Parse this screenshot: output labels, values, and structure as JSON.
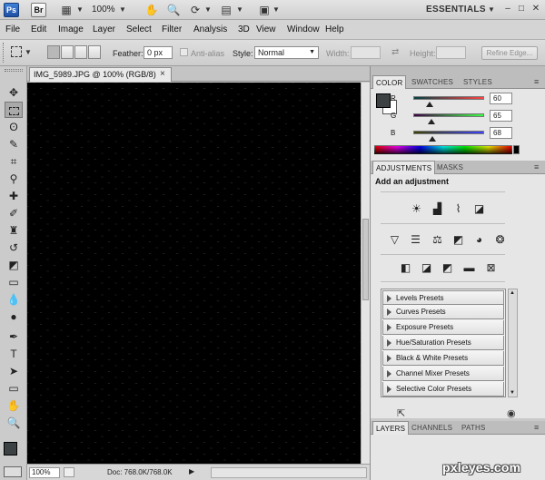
{
  "appbar": {
    "logo": "Ps",
    "bridge": "Br",
    "zoom": "100%",
    "workspace": "ESSENTIALS"
  },
  "menu": [
    "File",
    "Edit",
    "Image",
    "Layer",
    "Select",
    "Filter",
    "Analysis",
    "3D",
    "View",
    "Window",
    "Help"
  ],
  "options": {
    "feather_label": "Feather:",
    "feather_value": "0 px",
    "antialias_label": "Anti-alias",
    "style_label": "Style:",
    "style_value": "Normal",
    "width_label": "Width:",
    "height_label": "Height:",
    "refine_label": "Refine Edge..."
  },
  "document": {
    "tab_title": "IMG_5989.JPG @ 100% (RGB/8)",
    "close": "×",
    "zoom": "100%",
    "doc_info": "Doc: 768.0K/768.0K"
  },
  "color_panel": {
    "tabs": [
      "COLOR",
      "SWATCHES",
      "STYLES"
    ],
    "channels": [
      {
        "label": "R",
        "value": "60",
        "level": 0.235
      },
      {
        "label": "G",
        "value": "65",
        "level": 0.255
      },
      {
        "label": "B",
        "value": "68",
        "level": 0.267
      }
    ],
    "foreground": "#3c4144",
    "background": "#ffffff"
  },
  "adjustments_panel": {
    "tabs": [
      "ADJUSTMENTS",
      "MASKS"
    ],
    "title": "Add an adjustment",
    "presets": [
      "Levels Presets",
      "Curves Presets",
      "Exposure Presets",
      "Hue/Saturation Presets",
      "Black & White Presets",
      "Channel Mixer Presets",
      "Selective Color Presets"
    ]
  },
  "layers_panel": {
    "tabs": [
      "LAYERS",
      "CHANNELS",
      "PATHS"
    ]
  },
  "watermark": "pxleyes.com"
}
